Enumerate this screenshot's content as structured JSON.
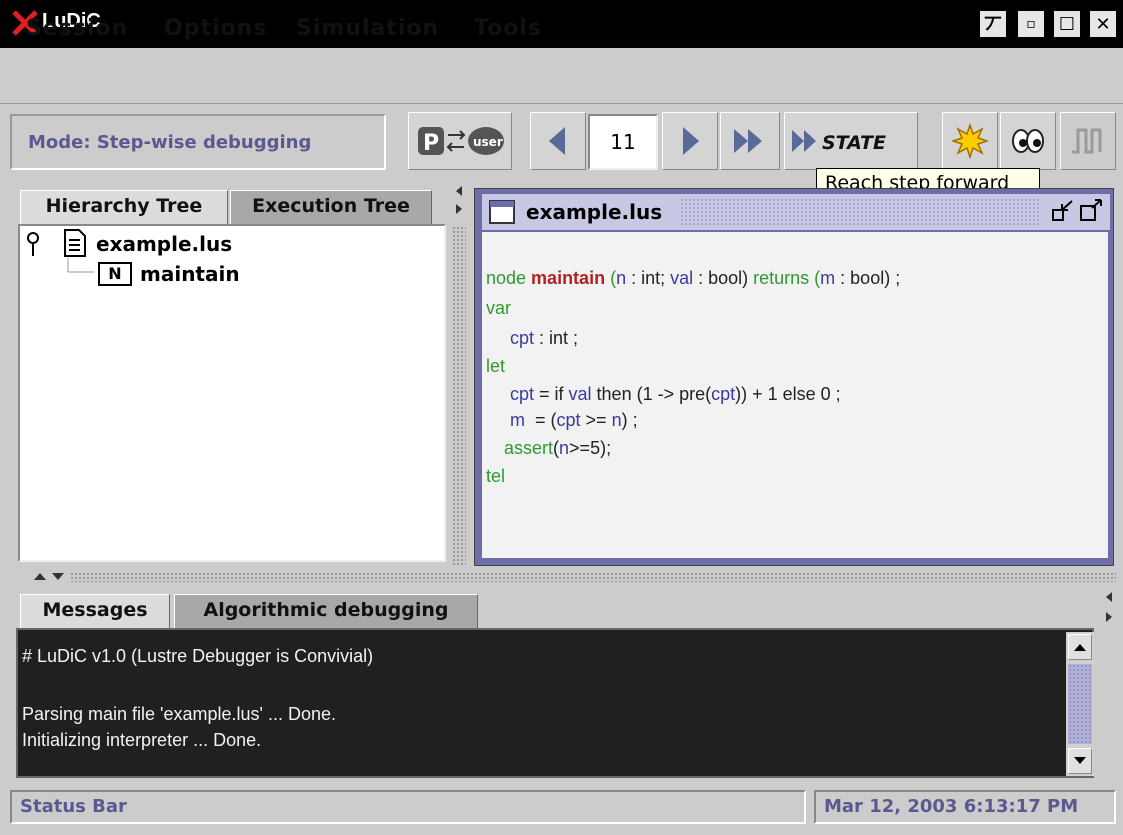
{
  "window": {
    "title": "LuDiC",
    "controls": [
      "丆",
      "▫",
      "☐",
      "✕"
    ]
  },
  "menu": [
    "Session",
    "Options",
    "Simulation",
    "Tools"
  ],
  "toolbar": {
    "mode": "Mode: Step-wise debugging",
    "mode_switch_p": "P",
    "mode_switch_user": "user",
    "step_value": "11",
    "state_button": "STATE",
    "tooltip": "Reach step forward"
  },
  "left_tabs": [
    "Hierarchy Tree",
    "Execution Tree"
  ],
  "tree": {
    "root": "example.lus",
    "child": "maintain",
    "child_badge": "N"
  },
  "editor": {
    "file": "example.lus",
    "code": {
      "l1_node": "node ",
      "l1_name": "maintain",
      "l1_a": " (",
      "l1_n": "n",
      "l1_b": " : int; ",
      "l1_val": "val",
      "l1_c": " : bool) ",
      "l1_returns": "returns",
      "l1_d": " (",
      "l1_m": "m",
      "l1_e": " : bool) ;",
      "l2_var": "var",
      "l3_cpt": "cpt",
      "l3_rest": " : int ;",
      "l4_let": "let",
      "l5_cpt": "cpt",
      "l5_a": " = if ",
      "l5_val": "val",
      "l5_b": " then (1 -> pre(",
      "l5_cpt2": "cpt",
      "l5_c": ")) + 1 else 0 ;",
      "l6_m": "m",
      "l6_a": "  = (",
      "l6_cpt": "cpt",
      "l6_b": " >= ",
      "l6_n": "n",
      "l6_c": ") ;",
      "l7_assert": "assert",
      "l7_a": "(",
      "l7_n": "n",
      "l7_b": ">=5);",
      "l8_tel": "tel"
    }
  },
  "bottom_tabs": [
    "Messages",
    "Algorithmic debugging"
  ],
  "messages": [
    "# LuDiC v1.0 (Lustre Debugger is Convivial)",
    "",
    "Parsing main file 'example.lus' ... Done.",
    "Initializing interpreter ... Done."
  ],
  "status": {
    "left": "Status Bar",
    "right": "Mar 12, 2003 6:13:17 PM"
  },
  "colors": {
    "accent": "#6e6ea6",
    "keyword": "#2f9a2f",
    "identifier": "#3a3aa0",
    "node_name": "#b22222",
    "messages_bg": "#202020"
  },
  "icons": [
    "app-x-icon",
    "tree-key-icon",
    "file-icon",
    "node-icon",
    "step-back-icon",
    "step-forward-icon",
    "fast-forward-icon",
    "burst-icon",
    "eyes-icon",
    "waveform-icon"
  ]
}
